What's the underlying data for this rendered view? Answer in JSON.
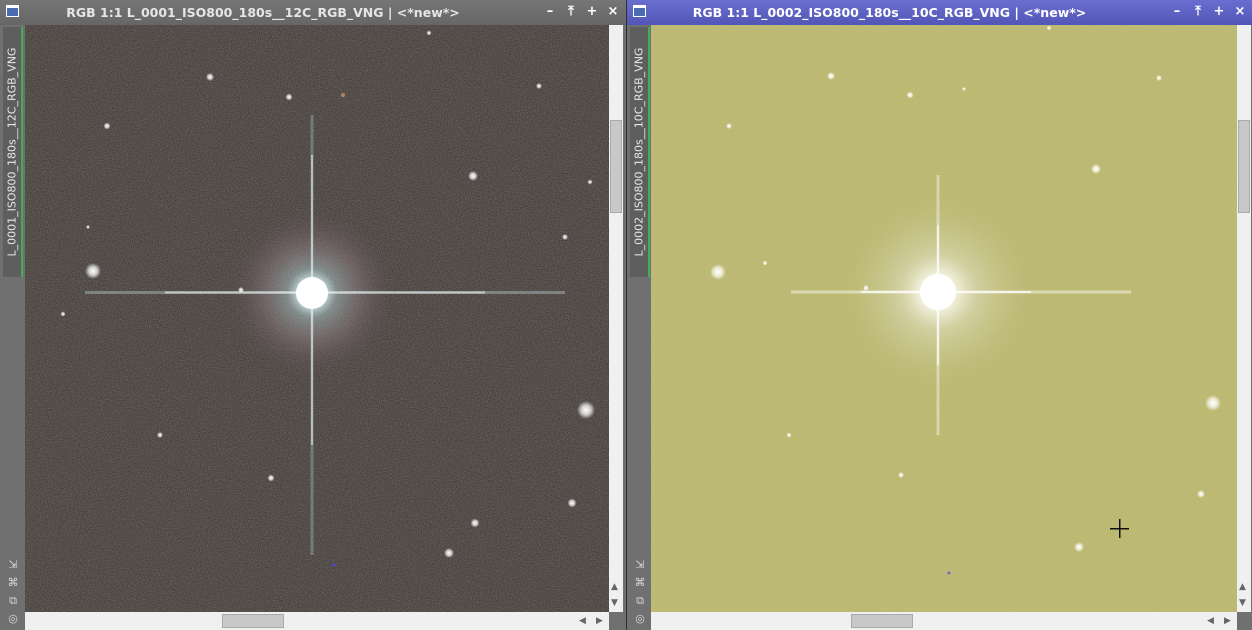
{
  "left_window": {
    "title": "RGB 1:1 L_0001_ISO800_180s__12C_RGB_VNG | <*new*>",
    "side_tab_label": "L_0001_ISO800_180s__12C_RGB_VNG",
    "controls": {
      "minimize": "–",
      "shade": "⤒",
      "maximize": "+",
      "close": "×"
    }
  },
  "right_window": {
    "title": "RGB 1:1 L_0002_ISO800_180s__10C_RGB_VNG | <*new*>",
    "side_tab_label": "L_0002_ISO800_180s__10C_RGB_VNG",
    "controls": {
      "minimize": "–",
      "shade": "⤒",
      "maximize": "+",
      "close": "×"
    }
  },
  "side_tools": {
    "resize": "⇲",
    "fit": "⌘",
    "clone": "⧉",
    "target": "◎"
  },
  "scroll_arrows": {
    "up": "▲",
    "down": "▼",
    "left": "◀",
    "right": "▶"
  },
  "colors": {
    "active_titlebar": "#5256b6",
    "inactive_titlebar": "#6a6a6a",
    "left_image_background": "#453f3c",
    "right_image_background": "#b9b66e",
    "side_tab_indicator": "#3fae54"
  },
  "icons": {
    "window_icon": "window-icon",
    "cursor": "crosshair-cursor-icon"
  }
}
